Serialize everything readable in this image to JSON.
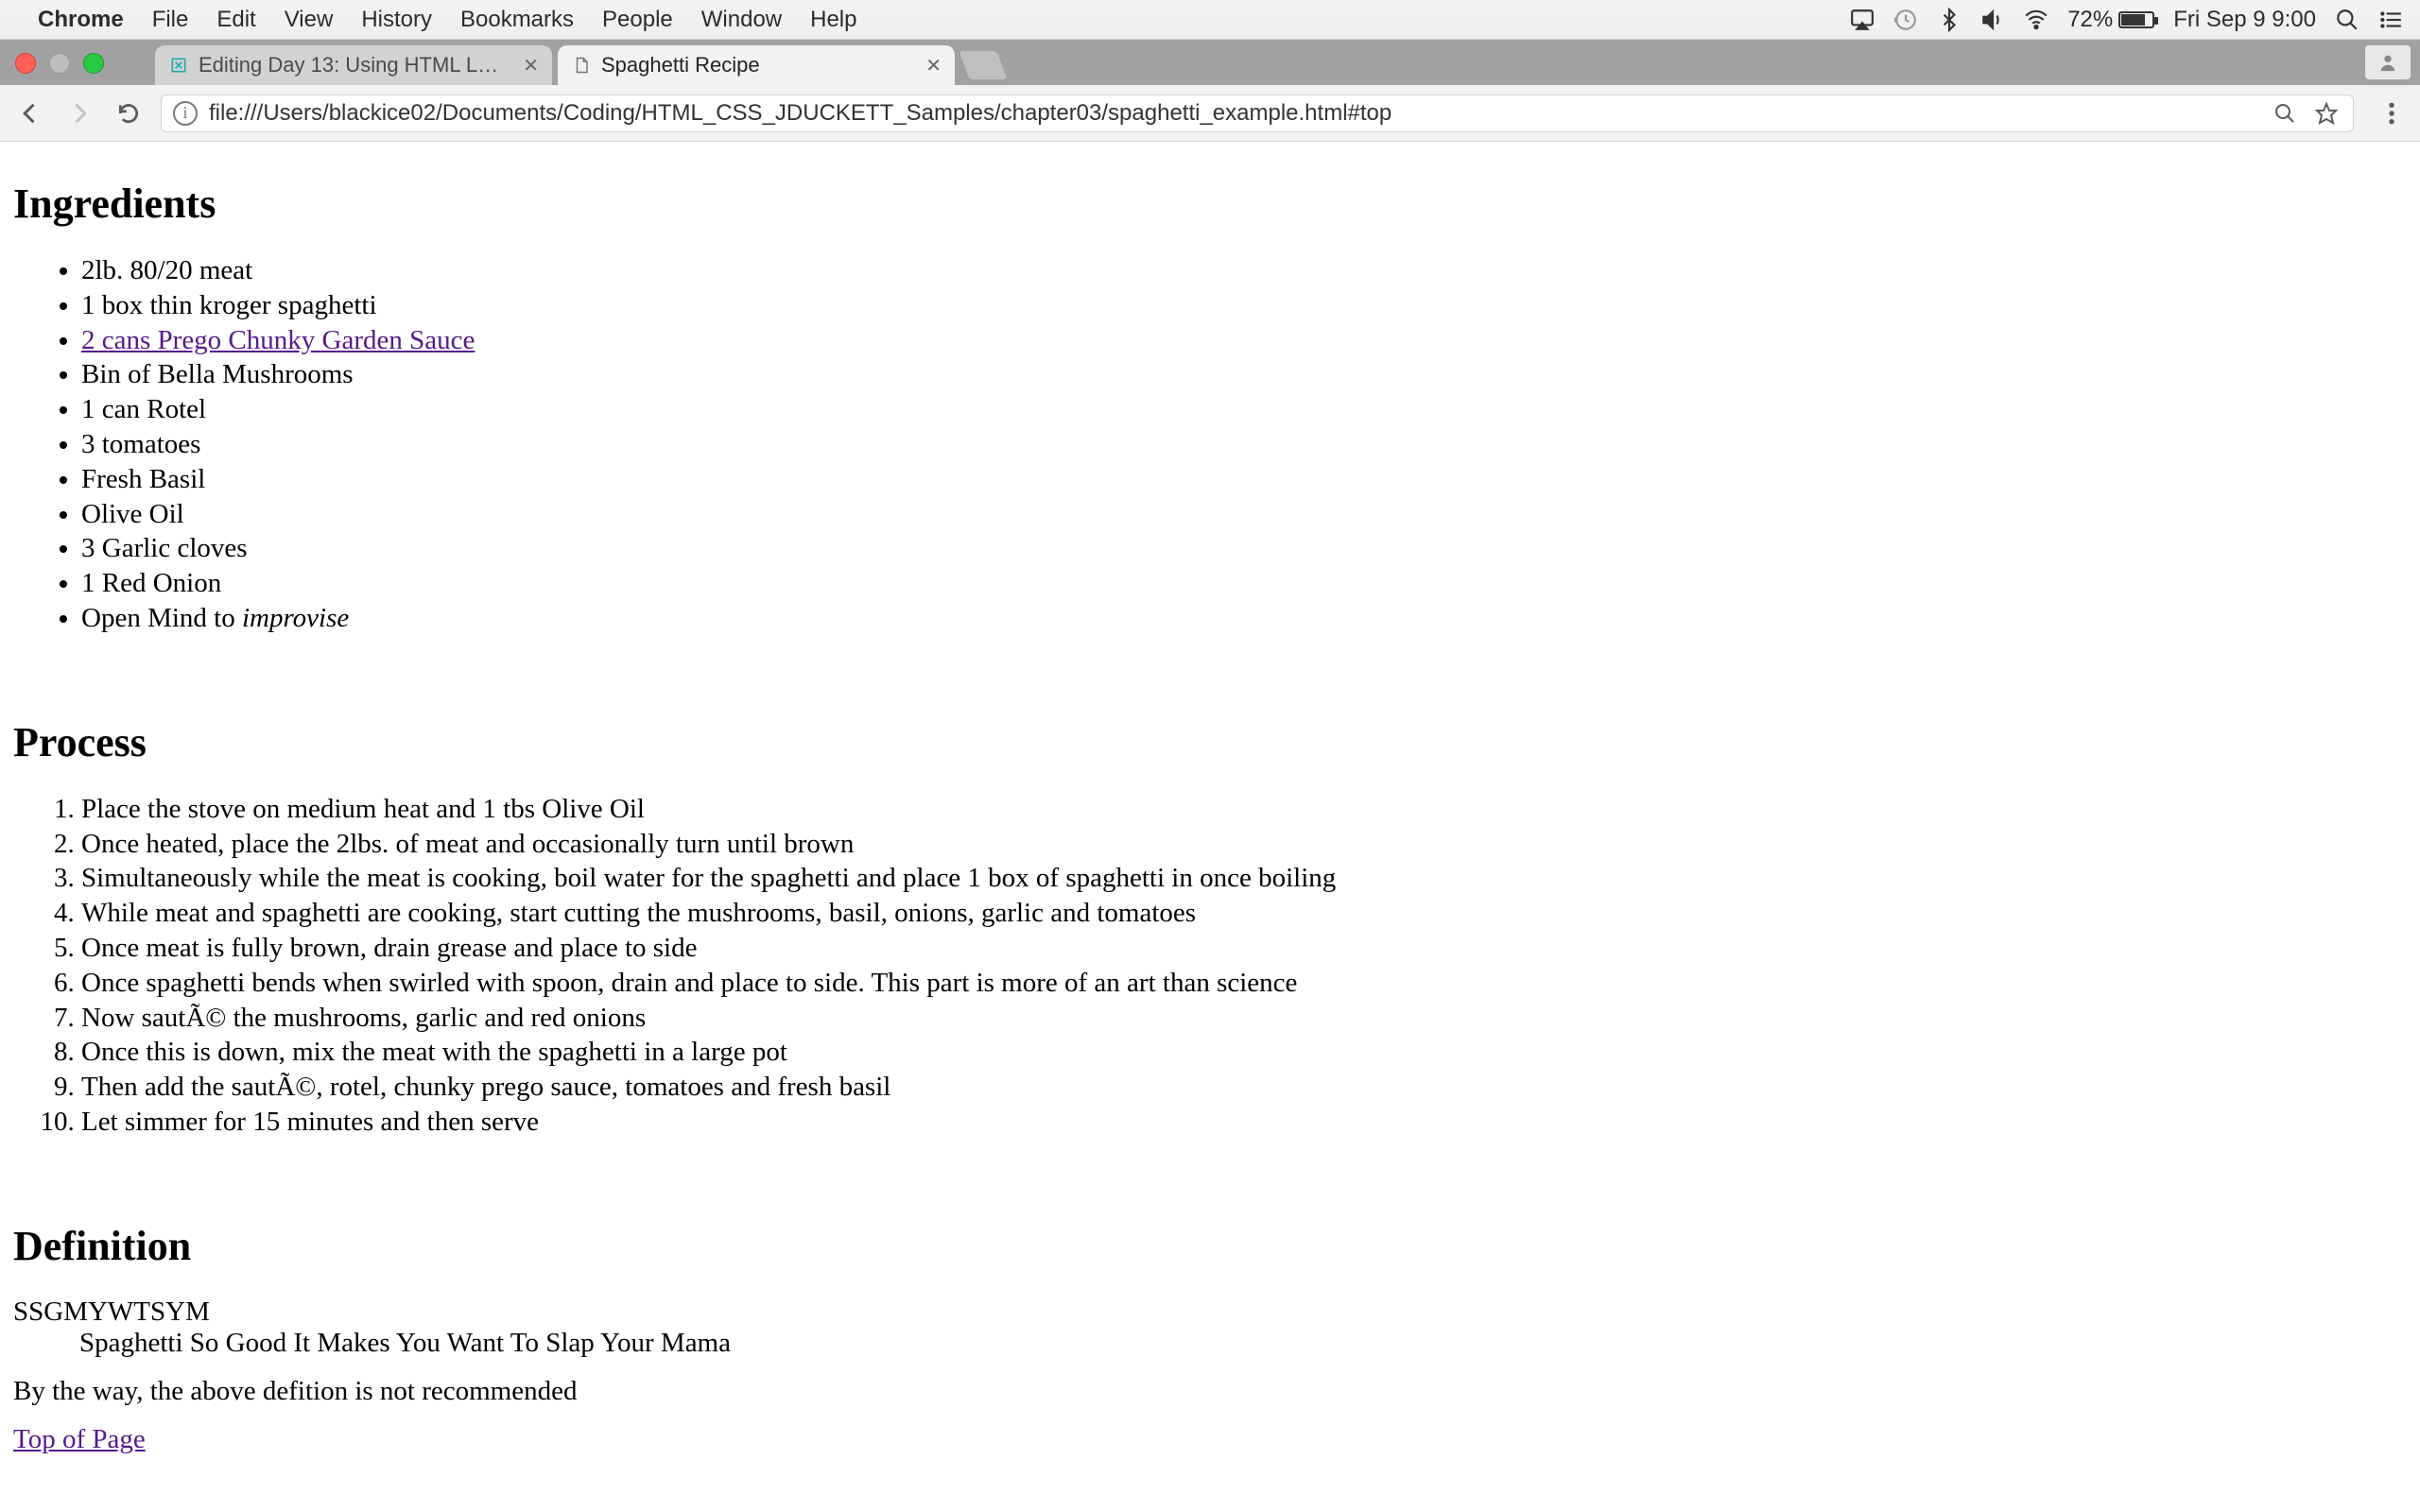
{
  "mac_menu": {
    "app": "Chrome",
    "items": [
      "File",
      "Edit",
      "View",
      "History",
      "Bookmarks",
      "People",
      "Window",
      "Help"
    ],
    "battery_pct": "72%",
    "datetime": "Fri Sep 9  9:00"
  },
  "browser": {
    "tabs": [
      {
        "title": "Editing Day 13: Using HTML L…",
        "active": false
      },
      {
        "title": "Spaghetti Recipe",
        "active": true
      }
    ],
    "url": "file:///Users/blackice02/Documents/Coding/HTML_CSS_JDUCKETT_Samples/chapter03/spaghetti_example.html#top"
  },
  "recipe": {
    "ingredients_heading": "Ingredients",
    "ingredients": [
      {
        "text": "2lb. 80/20 meat"
      },
      {
        "text": "1 box thin kroger spaghetti"
      },
      {
        "text": "2 cans Prego Chunky Garden Sauce",
        "link": true
      },
      {
        "text": "Bin of Bella Mushrooms"
      },
      {
        "text": "1 can Rotel"
      },
      {
        "text": "3 tomatoes"
      },
      {
        "text": "Fresh Basil"
      },
      {
        "text": "Olive Oil"
      },
      {
        "text": "3 Garlic cloves"
      },
      {
        "text": "1 Red Onion"
      },
      {
        "text_prefix": "Open Mind to ",
        "text_italic": "improvise"
      }
    ],
    "process_heading": "Process",
    "process": [
      "Place the stove on medium heat and 1 tbs Olive Oil",
      "Once heated, place the 2lbs. of meat and occasionally turn until brown",
      "Simultaneously while the meat is cooking, boil water for the spaghetti and place 1 box of spaghetti in once boiling",
      "While meat and spaghetti are cooking, start cutting the mushrooms, basil, onions, garlic and tomatoes",
      "Once meat is fully brown, drain grease and place to side",
      "Once spaghetti bends when swirled with spoon, drain and place to side. This part is more of an art than science",
      "Now sautÃ© the mushrooms, garlic and red onions",
      "Once this is down, mix the meat with the spaghetti in a large pot",
      "Then add the sautÃ©, rotel, chunky prego sauce, tomatoes and fresh basil",
      "Let simmer for 15 minutes and then serve"
    ],
    "definition_heading": "Definition",
    "definition_term": "SSGMYWTSYM",
    "definition_desc": "Spaghetti So Good It Makes You Want To Slap Your Mama",
    "note": "By the way, the above defition is not recommended",
    "top_link": "Top of Page"
  }
}
